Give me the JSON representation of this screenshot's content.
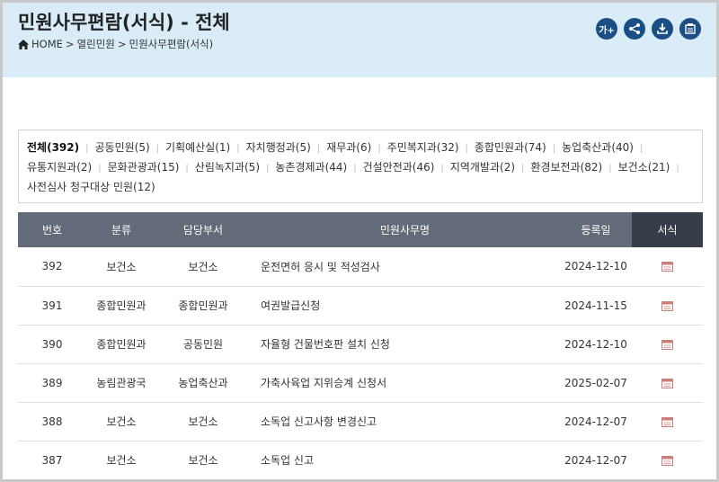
{
  "header": {
    "title": "민원사무편람(서식) - 전체",
    "breadcrumb": {
      "home": "HOME",
      "sep1": ">",
      "level1": "열린민원",
      "sep2": ">",
      "level2": "민원사무편람(서식)"
    },
    "tools": [
      {
        "name": "font-size-button",
        "label": "가+",
        "icon": "font-size-icon"
      },
      {
        "name": "share-button",
        "label": "",
        "icon": "share-icon"
      },
      {
        "name": "download-button",
        "label": "",
        "icon": "download-icon"
      },
      {
        "name": "print-button",
        "label": "",
        "icon": "print-icon"
      }
    ]
  },
  "filters": [
    {
      "label": "전체(392)",
      "active": true
    },
    {
      "label": "공동민원(5)"
    },
    {
      "label": "기획예산실(1)"
    },
    {
      "label": "자치행정과(5)"
    },
    {
      "label": "재무과(6)"
    },
    {
      "label": "주민복지과(32)"
    },
    {
      "label": "종합민원과(74)"
    },
    {
      "label": "농업축산과(40)"
    },
    {
      "label": "유통지원과(2)"
    },
    {
      "label": "문화관광과(15)"
    },
    {
      "label": "산림녹지과(5)"
    },
    {
      "label": "농촌경제과(44)"
    },
    {
      "label": "건설안전과(46)"
    },
    {
      "label": "지역개발과(2)"
    },
    {
      "label": "환경보전과(82)"
    },
    {
      "label": "보건소(21)"
    },
    {
      "label": "사전심사 청구대상 민원(12)"
    }
  ],
  "table": {
    "headers": [
      "번호",
      "분류",
      "담당부서",
      "민원사무명",
      "등록일",
      "서식"
    ],
    "rows": [
      {
        "no": "392",
        "category": "보건소",
        "dept": "보건소",
        "title": "운전면허 응시 및 적성검사",
        "date": "2024-12-10"
      },
      {
        "no": "391",
        "category": "종합민원과",
        "dept": "종합민원과",
        "title": "여권발급신청",
        "date": "2024-11-15"
      },
      {
        "no": "390",
        "category": "종합민원과",
        "dept": "공동민원",
        "title": "자율형 건물번호판 설치 신청",
        "date": "2024-12-10"
      },
      {
        "no": "389",
        "category": "농림관광국",
        "dept": "농업축산과",
        "title": "가축사육업 지위승계 신청서",
        "date": "2025-02-07"
      },
      {
        "no": "388",
        "category": "보건소",
        "dept": "보건소",
        "title": "소독업 신고사항 변경신고",
        "date": "2024-12-07"
      },
      {
        "no": "387",
        "category": "보건소",
        "dept": "보건소",
        "title": "소독업 신고",
        "date": "2024-12-07"
      }
    ]
  },
  "colors": {
    "header_bg": "#daecf8",
    "tool_button": "#1b4f84",
    "table_header": "#626b77",
    "table_header_form": "#373e4a",
    "form_icon": "#c9807a"
  }
}
